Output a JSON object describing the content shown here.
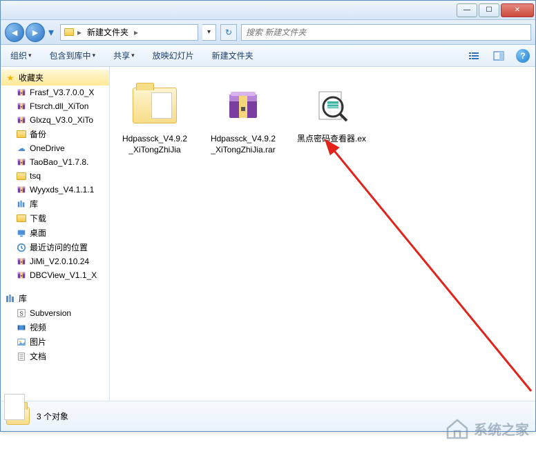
{
  "titlebar": {
    "min": "—",
    "max": "☐",
    "close": "✕"
  },
  "nav": {
    "back": "◄",
    "forward": "►",
    "dropdown": "▾",
    "refresh": "↻"
  },
  "breadcrumb": {
    "folder_icon": "📁",
    "segment1": "新建文件夹",
    "sep": "▸"
  },
  "search": {
    "placeholder": "搜索 新建文件夹"
  },
  "toolbar": {
    "organize": "组织",
    "include": "包含到库中",
    "share": "共享",
    "slideshow": "放映幻灯片",
    "newfolder": "新建文件夹",
    "caret": "▾"
  },
  "sidebar": {
    "favorites_label": "收藏夹",
    "fav_items": [
      {
        "icon": "rar",
        "label": "Frasf_V3.7.0.0_X"
      },
      {
        "icon": "rar",
        "label": "Ftsrch.dll_XiTon"
      },
      {
        "icon": "rar",
        "label": "Glxzq_V3.0_XiTo"
      },
      {
        "icon": "folder",
        "label": "备份"
      },
      {
        "icon": "cloud",
        "label": "OneDrive"
      },
      {
        "icon": "rar",
        "label": "TaoBao_V1.7.8."
      },
      {
        "icon": "folder",
        "label": "tsq"
      },
      {
        "icon": "rar",
        "label": "Wyyxds_V4.1.1.1"
      },
      {
        "icon": "lib",
        "label": "库"
      },
      {
        "icon": "folder",
        "label": "下载"
      },
      {
        "icon": "desktop",
        "label": "桌面"
      },
      {
        "icon": "recent",
        "label": "最近访问的位置"
      },
      {
        "icon": "rar",
        "label": "JiMi_V2.0.10.24"
      },
      {
        "icon": "rar",
        "label": "DBCView_V1.1_X"
      }
    ],
    "lib_label": "库",
    "lib_items": [
      {
        "icon": "svn",
        "label": "Subversion"
      },
      {
        "icon": "video",
        "label": "视频"
      },
      {
        "icon": "image",
        "label": "图片"
      },
      {
        "icon": "doc",
        "label": "文档"
      }
    ]
  },
  "files": [
    {
      "type": "folder",
      "label": "Hdpassck_V4.9.2_XiTongZhiJia"
    },
    {
      "type": "rar",
      "label": "Hdpassck_V4.9.2_XiTongZhiJia.rar"
    },
    {
      "type": "exe",
      "label": "黑点密码查看器.exe"
    }
  ],
  "statusbar": {
    "count_text": "3 个对象"
  },
  "watermark": {
    "text": "系统之家"
  }
}
